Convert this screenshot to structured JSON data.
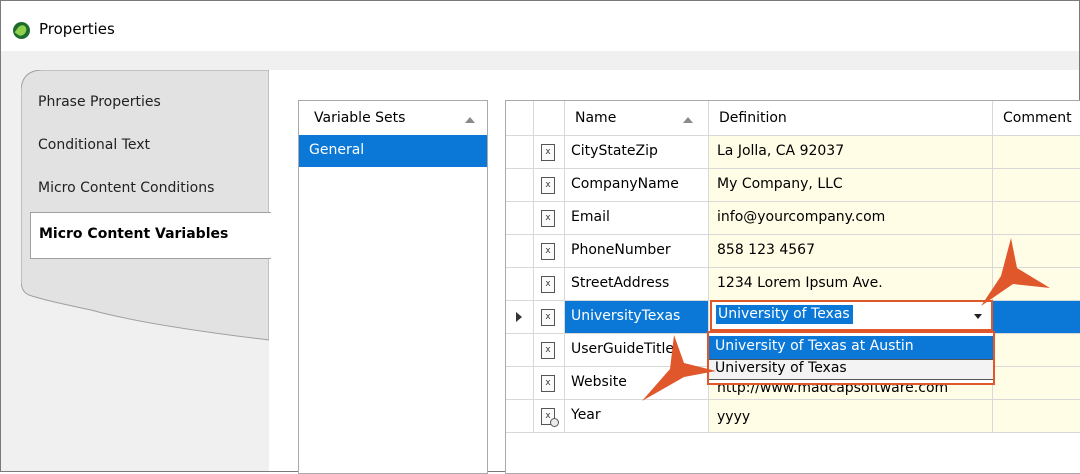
{
  "window": {
    "title": "Properties"
  },
  "side_tabs": [
    {
      "label": "Phrase Properties"
    },
    {
      "label": "Conditional Text"
    },
    {
      "label": "Micro Content Conditions"
    },
    {
      "label": "Micro Content Variables",
      "active": true
    }
  ],
  "variable_sets": {
    "header": "Variable Sets",
    "items": [
      "General"
    ],
    "selected": "General"
  },
  "grid": {
    "columns": {
      "name": "Name",
      "definition": "Definition",
      "comment": "Comment"
    },
    "rows": [
      {
        "name": "CityStateZip",
        "definition": "La Jolla, CA 92037",
        "icon": "text-variable-icon"
      },
      {
        "name": "CompanyName",
        "definition": "My Company, LLC",
        "icon": "text-variable-icon"
      },
      {
        "name": "Email",
        "definition": "info@yourcompany.com",
        "icon": "text-variable-icon"
      },
      {
        "name": "PhoneNumber",
        "definition": "858 123 4567",
        "icon": "text-variable-icon"
      },
      {
        "name": "StreetAddress",
        "definition": "1234 Lorem Ipsum Ave.",
        "icon": "text-variable-icon"
      },
      {
        "name": "UniversityTexas",
        "definition": "University of Texas",
        "icon": "text-variable-icon",
        "selected": true
      },
      {
        "name": "UserGuideTitle",
        "definition": "",
        "icon": "text-variable-icon"
      },
      {
        "name": "Website",
        "definition": "http://www.madcapsoftware.com",
        "icon": "text-variable-icon"
      },
      {
        "name": "Year",
        "definition": "yyyy",
        "icon": "date-variable-icon"
      }
    ]
  },
  "definition_editor": {
    "value": "University of Texas",
    "options": [
      "University of Texas at Austin",
      "University of Texas"
    ],
    "highlighted": "University of Texas at Austin"
  },
  "colors": {
    "selection": "#0b78d7",
    "callout": "#e0572c",
    "definition_bg": "#fffde6"
  }
}
